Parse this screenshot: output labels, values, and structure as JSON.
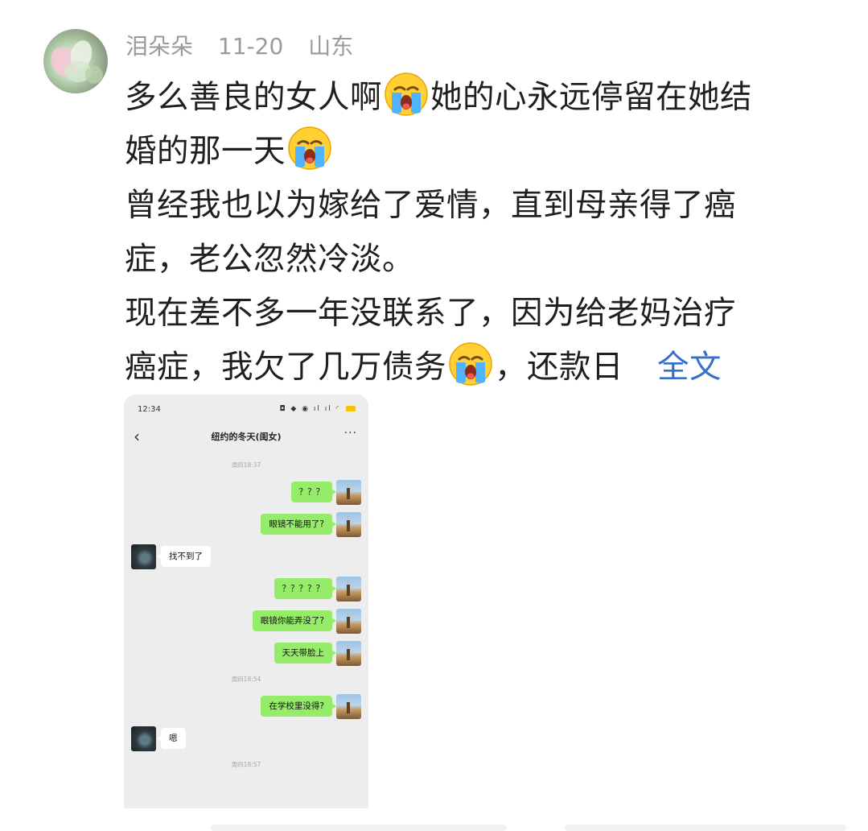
{
  "comment": {
    "username": "泪朵朵",
    "date": "11-20",
    "location": "山东",
    "lines": [
      {
        "segments": [
          {
            "t": "多么善良的女人啊"
          },
          {
            "emoji": "crying-face"
          },
          {
            "t": "她的心永远停留在她结"
          }
        ]
      },
      {
        "segments": [
          {
            "t": "婚的那一天"
          },
          {
            "emoji": "crying-face"
          }
        ]
      },
      {
        "segments": [
          {
            "t": "曾经我也以为嫁给了爱情，直到母亲得了癌"
          }
        ]
      },
      {
        "segments": [
          {
            "t": "症，老公忽然冷淡。"
          }
        ]
      },
      {
        "segments": [
          {
            "t": "现在差不多一年没联系了，因为给老妈治疗"
          }
        ]
      },
      {
        "segments": [
          {
            "t": "癌症，我欠了几万债务"
          },
          {
            "emoji": "crying-face"
          },
          {
            "t": "，还款日"
          }
        ]
      }
    ],
    "expand_label": "全文"
  },
  "screenshot": {
    "status_time": "12:34",
    "chat_title": "纽约的冬天(闺女)",
    "messages": [
      {
        "type": "time",
        "text": "周四18:37"
      },
      {
        "type": "msg",
        "from": "me",
        "text": "？？？"
      },
      {
        "type": "msg",
        "from": "me",
        "text": "眼镜不能用了?"
      },
      {
        "type": "msg",
        "from": "other",
        "text": "找不到了"
      },
      {
        "type": "msg",
        "from": "me",
        "text": "？？？？？"
      },
      {
        "type": "msg",
        "from": "me",
        "text": "眼镜你能弄没了?"
      },
      {
        "type": "msg",
        "from": "me",
        "text": "天天带脸上"
      },
      {
        "type": "time",
        "text": "周四18:54"
      },
      {
        "type": "msg",
        "from": "me",
        "text": "在学校里没得?"
      },
      {
        "type": "msg",
        "from": "other",
        "text": "嗯"
      },
      {
        "type": "time",
        "text": "周四18:57"
      }
    ]
  },
  "colors": {
    "link": "#3670c9",
    "meta": "#9a9a9a",
    "bubble_me": "#95ec69",
    "chat_bg": "#ededed"
  }
}
